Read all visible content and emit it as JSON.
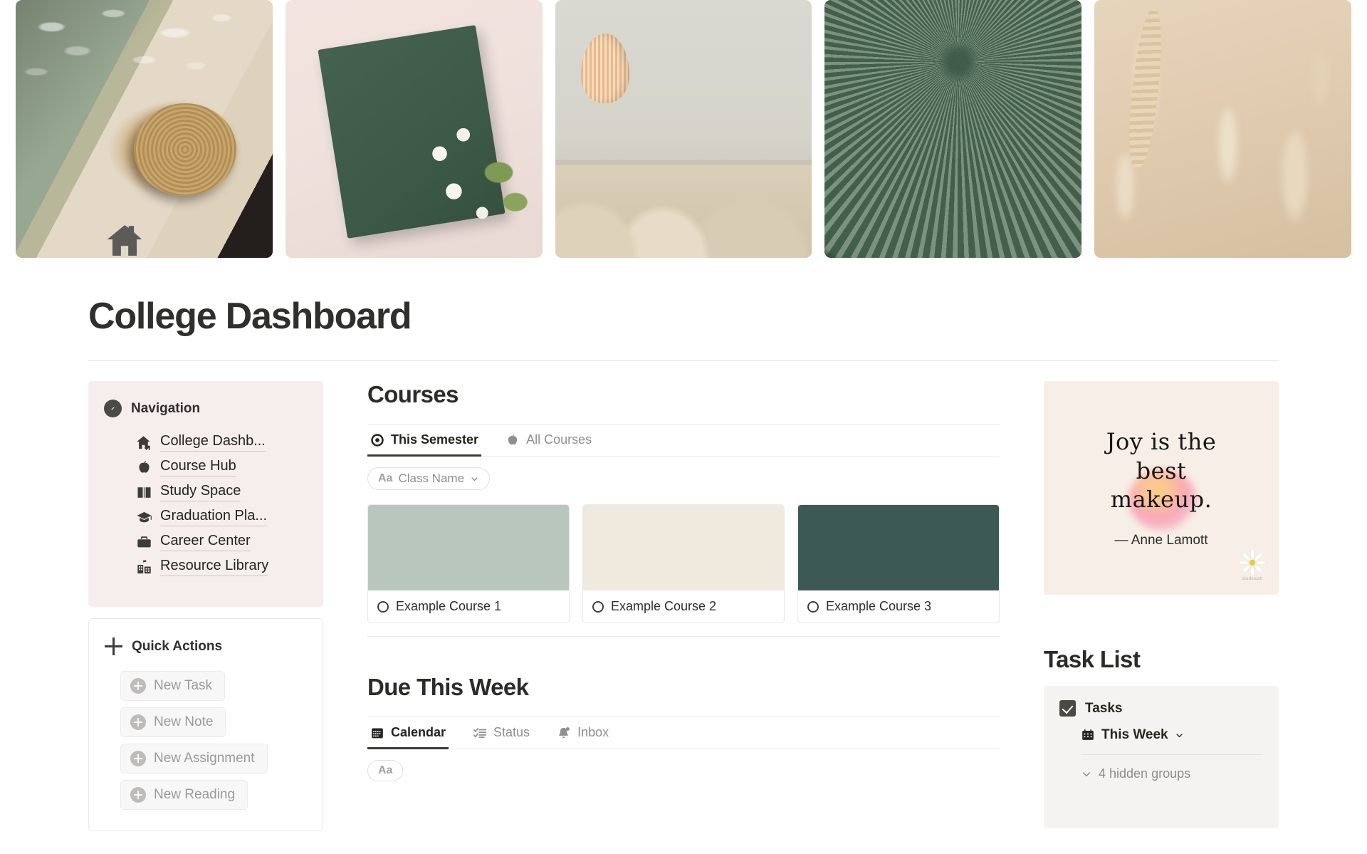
{
  "cover": {
    "images": [
      {
        "name": "pool-hat-photo",
        "alt": "Straw hat and sunglasses beside green pool water"
      },
      {
        "name": "green-book-photo",
        "alt": "Green hardcover book on pink linen with white flowers"
      },
      {
        "name": "hot-air-balloon-photo",
        "alt": "Hot air balloon over pale sand dunes"
      },
      {
        "name": "palm-frond-photo",
        "alt": "Close-up of a green fan palm frond"
      },
      {
        "name": "wheat-field-photo",
        "alt": "Golden wheat stalks in a blurred field"
      }
    ]
  },
  "header": {
    "icon": "home-icon",
    "title": "College Dashboard"
  },
  "sidebar": {
    "navigation": {
      "icon": "compass-icon",
      "title": "Navigation",
      "items": [
        {
          "icon": "house-arrow-icon",
          "label": "College Dashb..."
        },
        {
          "icon": "apple-icon",
          "label": "Course Hub"
        },
        {
          "icon": "open-book-icon",
          "label": "Study Space"
        },
        {
          "icon": "graduation-cap-icon",
          "label": "Graduation Pla..."
        },
        {
          "icon": "briefcase-icon",
          "label": "Career Center"
        },
        {
          "icon": "school-building-icon",
          "label": "Resource Library"
        }
      ]
    },
    "quick_actions": {
      "icon": "plus-icon",
      "title": "Quick Actions",
      "buttons": [
        {
          "icon": "circle-plus-icon",
          "label": "New Task"
        },
        {
          "icon": "circle-plus-icon",
          "label": "New Note"
        },
        {
          "icon": "circle-plus-icon",
          "label": "New Assignment"
        },
        {
          "icon": "circle-plus-icon",
          "label": "New Reading"
        }
      ]
    }
  },
  "courses": {
    "title": "Courses",
    "tabs": [
      {
        "icon": "circle-dot-icon",
        "label": "This Semester",
        "active": true
      },
      {
        "icon": "apple-icon",
        "label": "All Courses",
        "active": false
      }
    ],
    "filter_chip": {
      "prefix": "Aa",
      "label": "Class Name",
      "icon": "chevron-down-icon"
    },
    "cards": [
      {
        "label": "Example Course 1",
        "color": "#b9c6bd",
        "icon": "circle-icon"
      },
      {
        "label": "Example Course 2",
        "color": "#f0e9dd",
        "icon": "circle-icon"
      },
      {
        "label": "Example Course 3",
        "color": "#3d5954",
        "icon": "circle-icon"
      }
    ]
  },
  "due_this_week": {
    "title": "Due This Week",
    "tabs": [
      {
        "icon": "calendar-icon",
        "label": "Calendar",
        "active": true
      },
      {
        "icon": "checklist-icon",
        "label": "Status",
        "active": false
      },
      {
        "icon": "bell-icon",
        "label": "Inbox",
        "active": false
      }
    ]
  },
  "quote_card": {
    "line1": "Joy is the",
    "line2": "best",
    "line3": "makeup.",
    "attribution": "— Anne Lamott",
    "watermark": "studiocah",
    "background": "#f7efe7"
  },
  "task_list": {
    "title": "Task List",
    "group_label": "Tasks",
    "group_icon": "checkbox-checked-icon",
    "view": {
      "icon": "calendar-icon",
      "label": "This Week",
      "chevron": "chevron-down-icon"
    },
    "hidden_groups": {
      "icon": "chevron-down-icon",
      "label": "4 hidden groups"
    }
  }
}
